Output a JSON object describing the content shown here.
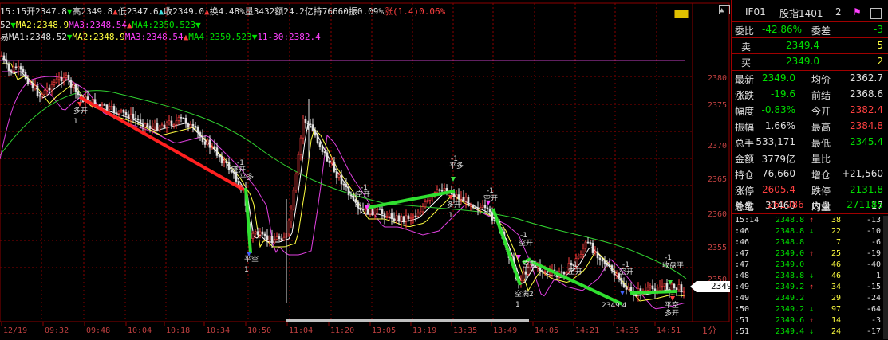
{
  "colors": {
    "up": "#ff4040",
    "down": "#00e000",
    "grid": "#8b0000",
    "bg": "#000000"
  },
  "header": {
    "line1": [
      {
        "t": "15:15",
        "c": "w"
      },
      {
        "t": "开2347.8",
        "c": "w"
      },
      {
        "t": "▼",
        "c": "g"
      },
      {
        "t": "高2349.8",
        "c": "w"
      },
      {
        "t": "▲",
        "c": "r"
      },
      {
        "t": "低2347.6",
        "c": "w"
      },
      {
        "t": "▲",
        "c": "c"
      },
      {
        "t": "收2349.0",
        "c": "w"
      },
      {
        "t": "▲",
        "c": "r"
      },
      {
        "t": "换4.48%",
        "c": "w"
      },
      {
        "t": "量3432",
        "c": "w"
      },
      {
        "t": "额24.2亿",
        "c": "w"
      },
      {
        "t": "持76660",
        "c": "w"
      },
      {
        "t": "振0.09%",
        "c": "w"
      },
      {
        "t": "涨(1.4)0.06%",
        "c": "r"
      }
    ],
    "line2": [
      {
        "t": "52",
        "c": "w"
      },
      {
        "t": "▼",
        "c": "g"
      },
      {
        "t": "MA2:2348.9",
        "c": "y"
      },
      {
        "t": "MA3:2348.54",
        "c": "m"
      },
      {
        "t": "▲",
        "c": "r"
      },
      {
        "t": "MA4:2350.523",
        "c": "g"
      },
      {
        "t": "▼",
        "c": "g"
      }
    ],
    "line3": [
      {
        "t": "易",
        "c": "w"
      },
      {
        "t": "MA1:2348.52",
        "c": "w"
      },
      {
        "t": "▼",
        "c": "g"
      },
      {
        "t": "MA2:2348.9",
        "c": "y"
      },
      {
        "t": "MA3:2348.54",
        "c": "m"
      },
      {
        "t": "▲",
        "c": "r"
      },
      {
        "t": "MA4:2350.523",
        "c": "g"
      },
      {
        "t": "▼",
        "c": "g"
      },
      {
        "t": "11-30:2382.4",
        "c": "m"
      }
    ]
  },
  "chart": {
    "yticks": [
      "2380",
      "2375",
      "2370",
      "2365",
      "2360",
      "2355",
      "2350"
    ],
    "xticks": [
      "12/19",
      "09:32",
      "09:48",
      "10:04",
      "10:18",
      "10:34",
      "10:50",
      "11:04",
      "11:20",
      "13:05",
      "13:19",
      "13:35",
      "13:49",
      "14:05",
      "14:21",
      "14:35",
      "14:51"
    ],
    "period": "1分",
    "current_price": "2349",
    "lines": [
      {
        "name": "red-trend",
        "color": "#ff2020",
        "pts": [
          [
            100,
            122
          ],
          [
            305,
            238
          ]
        ]
      },
      {
        "name": "green-drop",
        "color": "#30e030",
        "pts": [
          [
            308,
            236
          ],
          [
            314,
            318
          ]
        ]
      },
      {
        "name": "green-up",
        "color": "#30e030",
        "pts": [
          [
            460,
            261
          ],
          [
            570,
            240
          ]
        ]
      },
      {
        "name": "green-drop-2",
        "color": "#30e030",
        "pts": [
          [
            618,
            262
          ],
          [
            652,
            358
          ]
        ]
      },
      {
        "name": "green-rise",
        "color": "#30e030",
        "pts": [
          [
            655,
            330
          ],
          [
            665,
            325
          ]
        ]
      },
      {
        "name": "green-long",
        "color": "#30e030",
        "pts": [
          [
            665,
            328
          ],
          [
            780,
            382
          ]
        ]
      },
      {
        "name": "green-end",
        "color": "#30e030",
        "pts": [
          [
            790,
            368
          ],
          [
            848,
            366
          ]
        ]
      }
    ],
    "labels": [
      {
        "t": "多开",
        "c": "#e0e0e0",
        "x": 92,
        "y": 142
      },
      {
        "t": "1",
        "c": "#e0e0e0",
        "x": 92,
        "y": 155
      },
      {
        "t": "-1",
        "c": "#e0e0e0",
        "x": 297,
        "y": 207
      },
      {
        "t": "空开",
        "c": "#e0e0e0",
        "x": 290,
        "y": 216
      },
      {
        "t": "平多",
        "c": "#e0e0e0",
        "x": 300,
        "y": 225
      },
      {
        "t": "平空",
        "c": "#e0e0e0",
        "x": 306,
        "y": 328
      },
      {
        "t": "1",
        "c": "#e0e0e0",
        "x": 306,
        "y": 341
      },
      {
        "t": "-1",
        "c": "#e0e0e0",
        "x": 452,
        "y": 238
      },
      {
        "t": "空开",
        "c": "#e0e0e0",
        "x": 446,
        "y": 247
      },
      {
        "t": "-1",
        "c": "#e0e0e0",
        "x": 565,
        "y": 202
      },
      {
        "t": "平多",
        "c": "#e0e0e0",
        "x": 563,
        "y": 211
      },
      {
        "t": "多开",
        "c": "#e0e0e0",
        "x": 560,
        "y": 260
      },
      {
        "t": "1",
        "c": "#e0e0e0",
        "x": 562,
        "y": 273
      },
      {
        "t": "-1",
        "c": "#e0e0e0",
        "x": 610,
        "y": 242
      },
      {
        "t": "空开",
        "c": "#e0e0e0",
        "x": 606,
        "y": 252
      },
      {
        "t": "-1",
        "c": "#e0e0e0",
        "x": 652,
        "y": 298
      },
      {
        "t": "空开",
        "c": "#e0e0e0",
        "x": 650,
        "y": 308
      },
      {
        "t": "空开",
        "c": "#e0e0e0",
        "x": 655,
        "y": 335
      },
      {
        "t": "空满2",
        "c": "#e0e0e0",
        "x": 645,
        "y": 372
      },
      {
        "t": "1",
        "c": "#e0e0e0",
        "x": 646,
        "y": 385
      },
      {
        "t": "-1",
        "c": "#e0e0e0",
        "x": 715,
        "y": 335
      },
      {
        "t": "空开",
        "c": "#e0e0e0",
        "x": 712,
        "y": 344
      },
      {
        "t": "-1",
        "c": "#e0e0e0",
        "x": 780,
        "y": 335
      },
      {
        "t": "空开",
        "c": "#e0e0e0",
        "x": 776,
        "y": 344
      },
      {
        "t": "2349.4",
        "c": "#e0e0e0",
        "x": 754,
        "y": 386
      },
      {
        "t": "-1",
        "c": "#e0e0e0",
        "x": 833,
        "y": 326
      },
      {
        "t": "收盘平",
        "c": "#e0e0e0",
        "x": 830,
        "y": 336
      },
      {
        "t": "平空",
        "c": "#e0e0e0",
        "x": 833,
        "y": 386
      },
      {
        "t": "多开",
        "c": "#e0e0e0",
        "x": 833,
        "y": 396
      }
    ]
  },
  "panel": {
    "title": "IF01",
    "name": "股指1401",
    "num": "2",
    "weibi_label": "委比",
    "weibi": "-42.86%",
    "weicha_label": "委差",
    "weicha": "-3",
    "sell_label": "卖",
    "sell_price": "2349.4",
    "sell_vol": "5",
    "buy_label": "买",
    "buy_price": "2349.0",
    "buy_vol": "2",
    "rows": [
      {
        "l1": "最新",
        "v1": "2349.0",
        "c1": "#00e000",
        "l2": "均价",
        "v2": "2362.7",
        "c2": "#e0e0e0"
      },
      {
        "l1": "涨跌",
        "v1": "-19.6",
        "c1": "#00e000",
        "l2": "前结",
        "v2": "2368.6",
        "c2": "#e0e0e0"
      },
      {
        "l1": "幅度",
        "v1": "-0.83%",
        "c1": "#00e000",
        "l2": "今开",
        "v2": "2382.4",
        "c2": "#ff4040"
      },
      {
        "l1": "振幅",
        "v1": "1.66%",
        "c1": "#e0e0e0",
        "l2": "最高",
        "v2": "2384.8",
        "c2": "#ff4040"
      },
      {
        "l1": "总手",
        "v1": "533,171",
        "c1": "#e0e0e0",
        "l2": "最低",
        "v2": "2345.4",
        "c2": "#00e000"
      },
      {
        "l1": "金额",
        "v1": "3779亿",
        "c1": "#e0e0e0",
        "l2": "量比",
        "v2": "-",
        "c2": "#e0e0e0"
      },
      {
        "l1": "持仓",
        "v1": "76,660",
        "c1": "#e0e0e0",
        "l2": "增仓",
        "v2": "+21,560",
        "c2": "#e0e0e0"
      },
      {
        "l1": "涨停",
        "v1": "2605.4",
        "c1": "#ff4040",
        "l2": "跌停",
        "v2": "2131.8",
        "c2": "#00e000"
      },
      {
        "l1": "总笔",
        "v1": "31460",
        "c1": "#e0e0e0",
        "l2": "均量",
        "v2": "17",
        "c2": "#e0e0e0"
      }
    ],
    "waipan_label": "外盘",
    "waipan": "261986",
    "neipan_label": "内盘",
    "neipan": "271185",
    "ticks": [
      {
        "t": "15:14",
        "p": "2348.8",
        "a": "↑",
        "ac": "#ff4040",
        "v": "38",
        "d": "-13"
      },
      {
        "t": ":46",
        "p": "2348.8",
        "a": "↓",
        "ac": "#00e000",
        "v": "22",
        "d": "-10"
      },
      {
        "t": ":46",
        "p": "2348.8",
        "a": "",
        "ac": "#e0e0e0",
        "v": "7",
        "d": "-6"
      },
      {
        "t": ":47",
        "p": "2349.0",
        "a": "↑",
        "ac": "#ff4040",
        "v": "25",
        "d": "-19"
      },
      {
        "t": ":47",
        "p": "2349.0",
        "a": "",
        "ac": "#e0e0e0",
        "v": "46",
        "d": "-40"
      },
      {
        "t": ":48",
        "p": "2348.8",
        "a": "↓",
        "ac": "#00e000",
        "v": "46",
        "d": "1"
      },
      {
        "t": ":49",
        "p": "2349.2",
        "a": "↑",
        "ac": "#ff4040",
        "v": "34",
        "d": "-15"
      },
      {
        "t": ":49",
        "p": "2349.2",
        "a": "",
        "ac": "#e0e0e0",
        "v": "29",
        "d": "-24"
      },
      {
        "t": ":50",
        "p": "2349.2",
        "a": "↓",
        "ac": "#00e000",
        "v": "97",
        "d": "-64"
      },
      {
        "t": ":51",
        "p": "2349.6",
        "a": "↑",
        "ac": "#ff4040",
        "v": "14",
        "d": "-3"
      },
      {
        "t": ":51",
        "p": "2349.4",
        "a": "↓",
        "ac": "#00e000",
        "v": "24",
        "d": "-17"
      }
    ]
  }
}
